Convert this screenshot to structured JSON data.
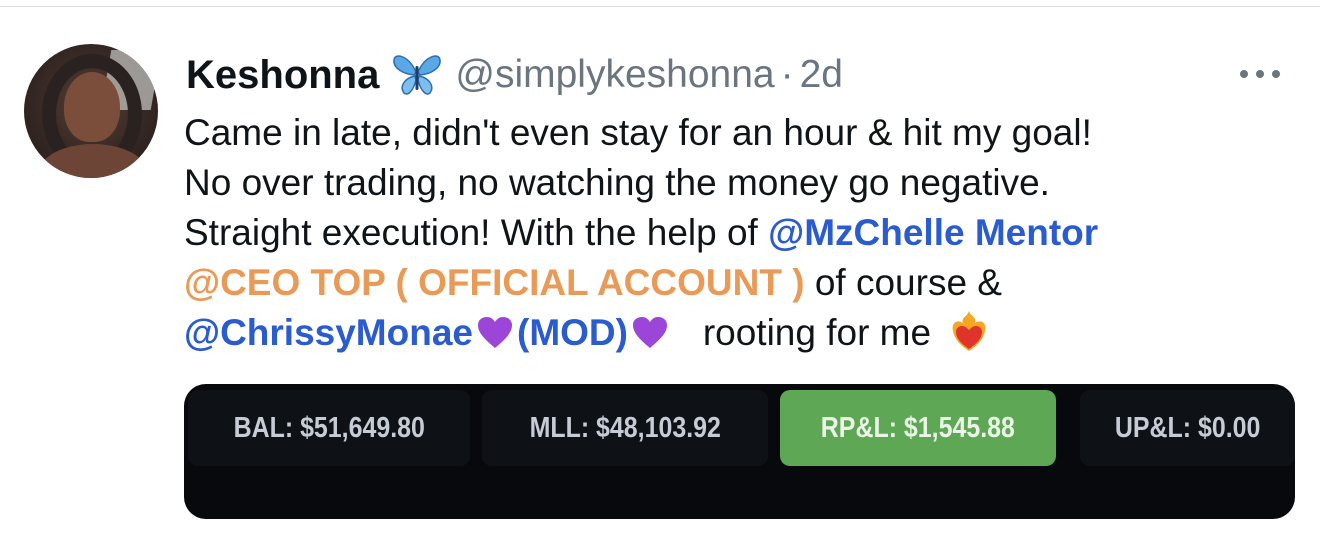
{
  "tweet": {
    "display_name": "Keshonna",
    "verified_icon": "butterfly-icon",
    "handle": "@simplykeshonna",
    "separator": "·",
    "time": "2d",
    "more_icon": "more-options-icon",
    "body": {
      "line1": "Came in late, didn't even stay for an hour & hit my goal!",
      "line2": "No over trading, no watching the money go negative.",
      "line3_text": "Straight execution! With the help of ",
      "mention1": "@MzChelle Mentor",
      "mention2": "@CEO TOP ( OFFICIAL ACCOUNT )",
      "line4_text": " of course &",
      "mention3_a": "@ChrissyMonae",
      "mention3_b": "(MOD)",
      "line5_text": "rooting for me",
      "emoji": [
        "purple-heart-icon",
        "purple-heart-icon",
        "heart-on-fire-icon"
      ]
    },
    "colors": {
      "mention_blue": "#2a5bcf",
      "mention_orange": "#ea9a57",
      "muted_text": "#6b7580",
      "rpl_green": "#5ea754"
    }
  },
  "media": {
    "stats": [
      {
        "label": "BAL: $51,649.80"
      },
      {
        "label": "MLL: $48,103.92"
      },
      {
        "label": "RP&L: $1,545.88"
      },
      {
        "label": "UP&L: $0.00"
      }
    ]
  }
}
